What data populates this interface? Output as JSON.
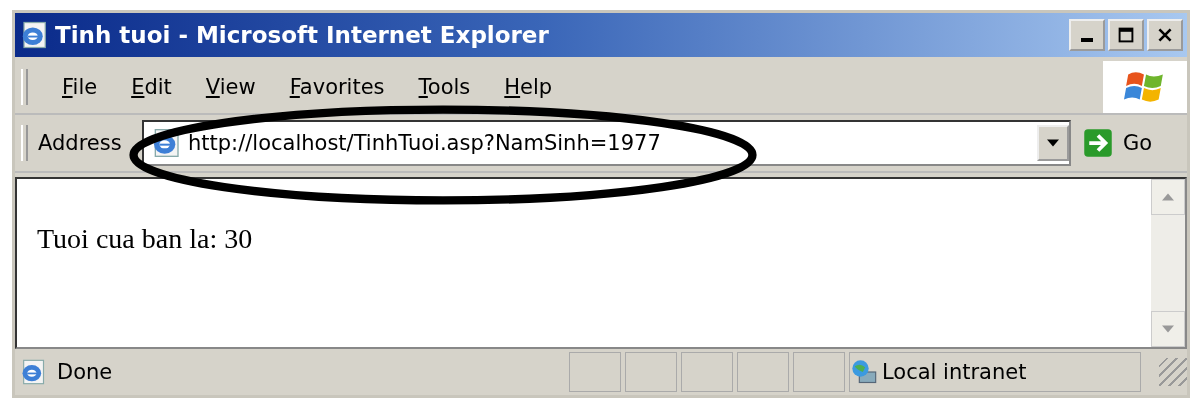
{
  "window": {
    "title": "Tinh tuoi - Microsoft Internet Explorer"
  },
  "menu": [
    "File",
    "Edit",
    "View",
    "Favorites",
    "Tools",
    "Help"
  ],
  "address_bar": {
    "label": "Address",
    "value": "http://localhost/TinhTuoi.asp?NamSinh=1977",
    "go": "Go"
  },
  "page": {
    "text": "Tuoi cua ban la: 30"
  },
  "status_bar": {
    "text": "Done",
    "zone": "Local intranet"
  },
  "annotation": {
    "kind": "ellipse"
  }
}
